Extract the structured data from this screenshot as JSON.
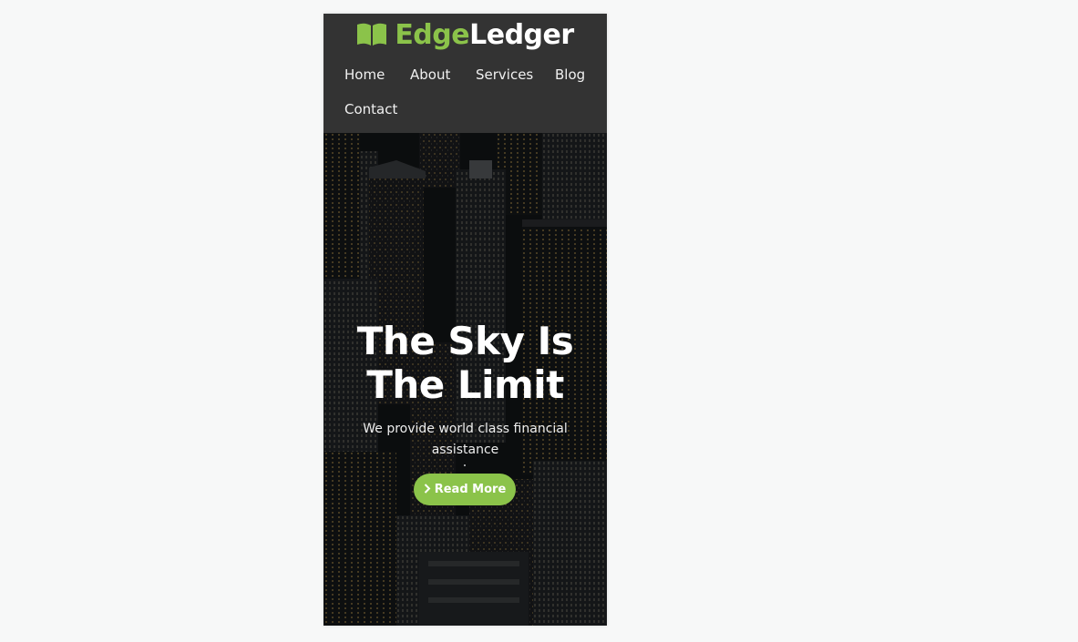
{
  "brand": {
    "name_part1": "Edge",
    "name_part2": "Ledger",
    "logo_icon": "open-book-icon",
    "accent_color": "#8bc34a"
  },
  "nav": {
    "items": [
      {
        "label": "Home"
      },
      {
        "label": "About"
      },
      {
        "label": "Services"
      },
      {
        "label": "Blog"
      },
      {
        "label": "Contact"
      }
    ]
  },
  "hero": {
    "title_line1": "The Sky Is",
    "title_line2": "The Limit",
    "subtitle": "We provide world class financial assistance",
    "button_label": "Read More",
    "button_icon": "chevron-right-icon"
  },
  "colors": {
    "header_bg": "#333333",
    "page_bg": "#f7f8f8",
    "button_bg": "#8bc34a"
  }
}
